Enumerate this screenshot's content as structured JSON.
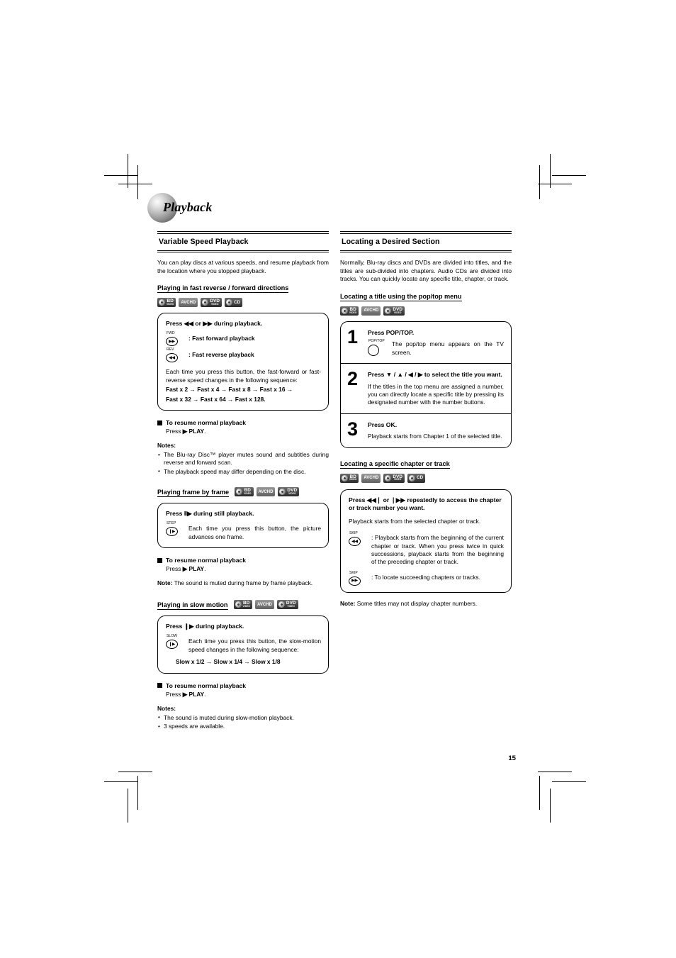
{
  "header": {
    "chapter": "Playback"
  },
  "page_number": "15",
  "left_column": {
    "section": {
      "title": "Variable Speed Playback"
    },
    "intro": "You can play discs at various speeds, and resume playback from the location where you stopped playback.",
    "sub1": {
      "heading": "Playing in fast reverse / forward directions",
      "badges": [
        "BD",
        "AVCHD",
        "DVD",
        "CD"
      ],
      "box": {
        "header": "Press ◀◀ or ▶▶ during playback.",
        "fwd_cap": "FWD",
        "fwd_text": ": Fast forward playback",
        "rev_cap": "REV",
        "rev_text": ": Fast reverse playback",
        "body": "Each time you press this button, the fast-forward or fast-reverse speed changes in the following sequence:",
        "sequence_line1": "Fast x 2 → Fast x 4 → Fast x 8 → Fast x 16 →",
        "sequence_line2": "Fast x 32 → Fast x 64 → Fast x 128."
      },
      "resume_heading": "To resume normal playback",
      "resume_text_pre": "Press",
      "resume_text_key": "▶ PLAY",
      "resume_text_post": ".",
      "notes_title": "Notes:",
      "notes": [
        "The Blu-ray Disc™ player mutes sound and subtitles during reverse and forward scan.",
        "The playback speed may differ depending on the disc."
      ]
    },
    "sub2": {
      "heading": "Playing frame by frame",
      "badges": [
        "BD",
        "AVCHD",
        "DVD"
      ],
      "box": {
        "header": "Press Ⅱ▶ during still playback.",
        "step_cap": "STEP",
        "body": "Each time you press this button, the picture advances one frame."
      },
      "resume_heading": "To resume normal playback",
      "resume_text_pre": "Press",
      "resume_text_key": "▶ PLAY",
      "resume_text_post": ".",
      "note_label": "Note:",
      "note_text": "The sound is muted during frame by frame playback."
    },
    "sub3": {
      "heading": "Playing in slow motion",
      "badges": [
        "BD",
        "AVCHD",
        "DVD"
      ],
      "box": {
        "header": "Press ❙▶ during playback.",
        "slow_cap": "SLOW",
        "body": "Each time you press this button, the slow-motion speed changes in the following sequence:",
        "sequence": "Slow x 1/2 → Slow x 1/4 → Slow x 1/8"
      },
      "resume_heading": "To resume normal playback",
      "resume_text_pre": "Press",
      "resume_text_key": "▶ PLAY",
      "resume_text_post": ".",
      "notes_title": "Notes:",
      "notes": [
        "The sound is muted during slow-motion playback.",
        "3 speeds are available."
      ]
    }
  },
  "right_column": {
    "section": {
      "title": "Locating a Desired Section"
    },
    "intro": "Normally, Blu-ray discs and DVDs are divided into titles, and the titles are sub-divided into chapters. Audio CDs are divided into tracks. You can quickly locate any specific title, chapter, or track.",
    "sub1": {
      "heading": "Locating a title using the pop/top menu",
      "badges": [
        "BD",
        "AVCHD",
        "DVD"
      ],
      "steps": [
        {
          "num": "1",
          "title": "Press POP/TOP.",
          "key_cap": "POP/TOP",
          "text": "The pop/top menu appears on the TV screen."
        },
        {
          "num": "2",
          "title": "Press ▼ / ▲ / ◀ / ▶ to select the title you want.",
          "text": "If the titles in the top menu are assigned a number, you can directly locate a specific title by pressing its designated number with the number buttons."
        },
        {
          "num": "3",
          "title": "Press OK.",
          "text": "Playback starts from Chapter 1 of the selected title."
        }
      ]
    },
    "sub2": {
      "heading": "Locating a specific chapter or track",
      "badges": [
        "BD",
        "AVCHD",
        "DVD",
        "CD"
      ],
      "box": {
        "header": "Press ◀◀❘ or ❘▶▶ repeatedly to access the chapter or track number you want.",
        "body": "Playback starts from the selected chapter or track.",
        "skip_prev_cap": "SKIP",
        "skip_prev_text": ": Playback starts from the beginning of the current chapter or track. When you press twice in quick successions, playback starts from the beginning of the preceding chapter or track.",
        "skip_next_cap": "SKIP",
        "skip_next_text": ": To locate succeeding chapters or tracks."
      },
      "note_label": "Note:",
      "note_text": "Some titles may not display chapter numbers."
    }
  }
}
